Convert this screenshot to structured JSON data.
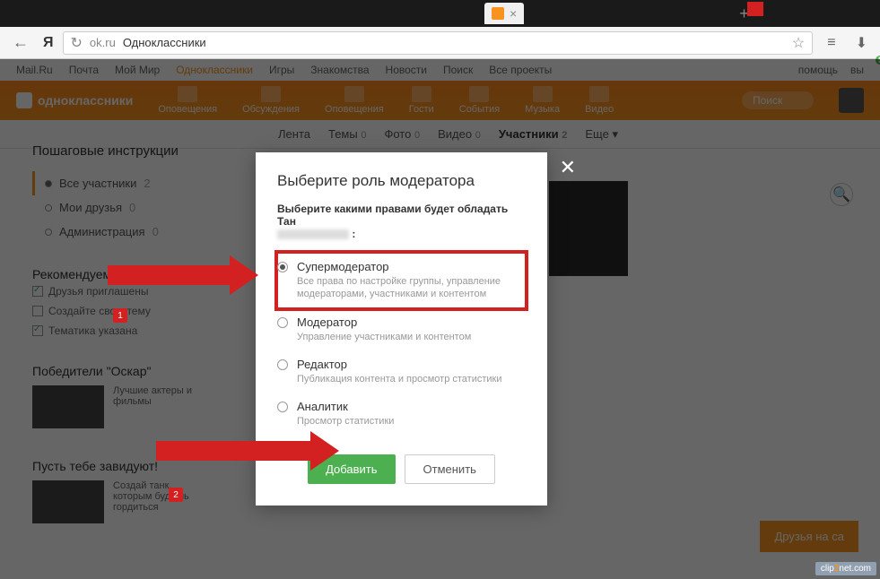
{
  "browser": {
    "tab_close": "×",
    "new_tab": "+",
    "url_domain": "ok.ru",
    "url_title": "Одноклассники"
  },
  "topnav": {
    "links": [
      "Mail.Ru",
      "Почта",
      "Мой Мир",
      "Одноклассники",
      "Игры",
      "Знакомства",
      "Новости",
      "Поиск",
      "Все проекты"
    ],
    "right": [
      "помощь",
      "вы"
    ]
  },
  "header": {
    "logo": "одноклассники",
    "items": [
      "Оповещения",
      "Обсуждения",
      "Оповещения",
      "Гости",
      "События",
      "Музыка",
      "Видео"
    ],
    "search": "Поиск"
  },
  "tabs": {
    "items": [
      {
        "label": "Лента",
        "count": ""
      },
      {
        "label": "Темы",
        "count": "0"
      },
      {
        "label": "Фото",
        "count": "0"
      },
      {
        "label": "Видео",
        "count": "0"
      },
      {
        "label": "Участники",
        "count": "2"
      },
      {
        "label": "Еще ▾",
        "count": ""
      }
    ]
  },
  "sidebar": {
    "heading": "Пошаговые инструкции",
    "filters": [
      {
        "label": "Все участники",
        "count": "2"
      },
      {
        "label": "Мои друзья",
        "count": "0"
      },
      {
        "label": "Администрация",
        "count": "0"
      }
    ],
    "recommend": "Рекомендуем",
    "checks": [
      "Друзья приглашены",
      "Создайте свою тему",
      "Тематика указана"
    ],
    "oscar_title": "Победители \"Оскар\"",
    "oscar_text": "Лучшие актеры и фильмы",
    "envy_title": "Пусть тебе завидуют!",
    "envy_text": "Создай танк, которым будешь гордиться"
  },
  "modal": {
    "title": "Выберите роль модератора",
    "subtitle": "Выберите какими правами будет обладать Тан",
    "roles": [
      {
        "name": "Супермодератор",
        "desc": "Все права по настройке группы, управление модераторами, участниками и контентом"
      },
      {
        "name": "Модератор",
        "desc": "Управление участниками и контентом"
      },
      {
        "name": "Редактор",
        "desc": "Публикация контента и просмотр статистики"
      },
      {
        "name": "Аналитик",
        "desc": "Просмотр статистики"
      }
    ],
    "add": "Добавить",
    "cancel": "Отменить",
    "close": "✕"
  },
  "cta": "Друзья на са",
  "arrows": {
    "n1": "1",
    "n2": "2"
  },
  "watermark": {
    "a": "clip",
    "b": "2",
    "c": "net.com"
  }
}
